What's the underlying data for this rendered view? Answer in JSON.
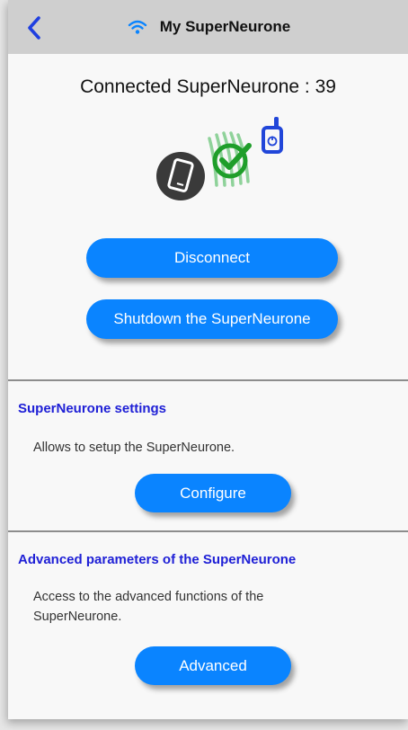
{
  "nav": {
    "title": "My SuperNeurone",
    "back_icon": "chevron-left-icon",
    "wifi_icon": "wifi-icon"
  },
  "connection": {
    "title": "Connected SuperNeurone : 39",
    "graphic_icons": [
      "phone-icon",
      "check-circle-icon",
      "device-icon"
    ]
  },
  "actions": {
    "disconnect_label": "Disconnect",
    "shutdown_label": "Shutdown the SuperNeurone"
  },
  "settings_section": {
    "title": "SuperNeurone settings",
    "description": "Allows to setup the SuperNeurone.",
    "button_label": "Configure"
  },
  "advanced_section": {
    "title": "Advanced parameters of the SuperNeurone",
    "description_line1": "Access to the advanced functions of the",
    "description_line2": "SuperNeurone.",
    "button_label": "Advanced"
  },
  "colors": {
    "accent": "#0a84ff",
    "section_title": "#1f20d6",
    "check_green": "#1f9e2a",
    "device_blue": "#2146d9",
    "nav_bar": "#cfcfcf"
  }
}
